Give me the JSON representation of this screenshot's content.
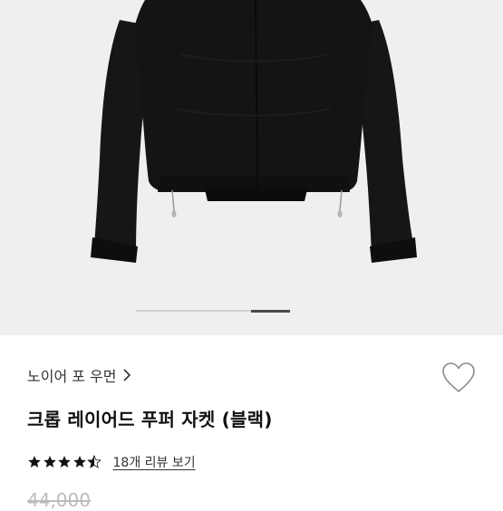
{
  "product": {
    "brand": "노이어 포 우먼",
    "title": "크롭 레이어드 푸퍼 자켓 (블랙)",
    "rating": 4.5,
    "rating_max": 5,
    "review_link": "18개 리뷰 보기",
    "original_price": "44,000"
  },
  "gallery": {
    "current_slide_fraction": 0.75,
    "background_color": "#efefef",
    "jacket_color": "#141414"
  },
  "icons": {
    "brand_chevron": "chevron-right-icon",
    "wishlist": "heart-outline-icon",
    "star": "star-icon"
  }
}
